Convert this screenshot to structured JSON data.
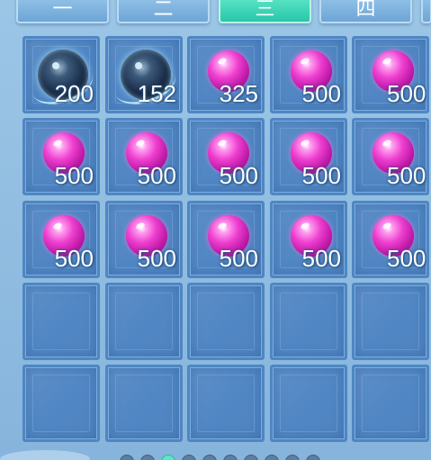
{
  "tabs": [
    {
      "label": "一",
      "active": false
    },
    {
      "label": "二",
      "active": false
    },
    {
      "label": "三",
      "active": true
    },
    {
      "label": "四",
      "active": false
    }
  ],
  "inventory": {
    "rows": [
      [
        {
          "item": "blue-orb",
          "qty": "200"
        },
        {
          "item": "blue-orb",
          "qty": "152"
        },
        {
          "item": "pink-orb",
          "qty": "325"
        },
        {
          "item": "pink-orb",
          "qty": "500"
        },
        {
          "item": "pink-orb",
          "qty": "500"
        }
      ],
      [
        {
          "item": "pink-orb",
          "qty": "500"
        },
        {
          "item": "pink-orb",
          "qty": "500"
        },
        {
          "item": "pink-orb",
          "qty": "500"
        },
        {
          "item": "pink-orb",
          "qty": "500"
        },
        {
          "item": "pink-orb",
          "qty": "500"
        }
      ],
      [
        {
          "item": "pink-orb",
          "qty": "500"
        },
        {
          "item": "pink-orb",
          "qty": "500"
        },
        {
          "item": "pink-orb",
          "qty": "500"
        },
        {
          "item": "pink-orb",
          "qty": "500"
        },
        {
          "item": "pink-orb",
          "qty": "500"
        }
      ],
      [
        {
          "item": "empty",
          "qty": ""
        },
        {
          "item": "empty",
          "qty": ""
        },
        {
          "item": "empty",
          "qty": ""
        },
        {
          "item": "empty",
          "qty": ""
        },
        {
          "item": "empty",
          "qty": ""
        }
      ],
      [
        {
          "item": "empty",
          "qty": ""
        },
        {
          "item": "empty",
          "qty": ""
        },
        {
          "item": "empty",
          "qty": ""
        },
        {
          "item": "empty",
          "qty": ""
        },
        {
          "item": "empty",
          "qty": ""
        }
      ]
    ]
  },
  "pagination": {
    "page_count": 10,
    "active_index": 2
  },
  "colors": {
    "tab_active": "#28c6a8",
    "tab_inactive": "#6ea5d6",
    "cell_bg": "#5187c4",
    "pink_orb": "#ee3fcf",
    "blue_orb": "#1b2f4b"
  }
}
